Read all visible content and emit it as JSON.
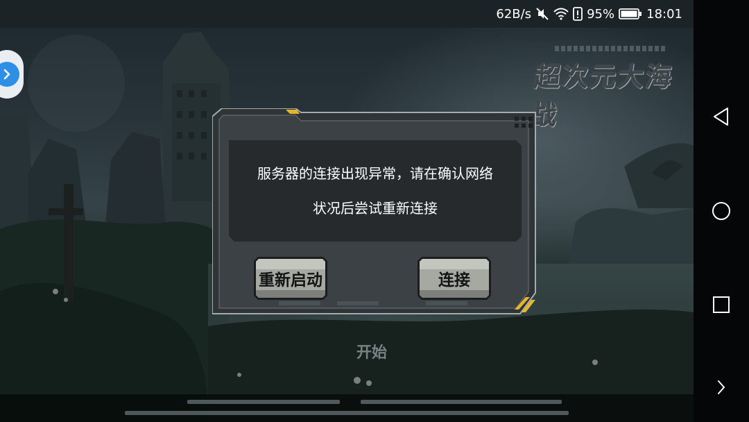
{
  "status_bar": {
    "net_speed": "62B/s",
    "battery_percent": "95%",
    "time": "18:01",
    "icons": [
      "mute-icon",
      "wifi-icon",
      "alert-icon",
      "battery-icon"
    ]
  },
  "game": {
    "logo_text": "超次元大海战",
    "start_label": "开始"
  },
  "dialog": {
    "message_line1": "服务器的连接出现异常，请在确认网络",
    "message_line2": "状况后尝试重新连接",
    "restart_label": "重新启动",
    "connect_label": "连接"
  },
  "nav_bar": {
    "buttons": [
      "back-icon",
      "home-icon",
      "recents-icon",
      "expand-icon"
    ]
  },
  "colors": {
    "dialog_frame": "#3b4145",
    "panel": "#272b2e",
    "accent": "#e5b52a",
    "button_face": "#a6a9a2"
  }
}
